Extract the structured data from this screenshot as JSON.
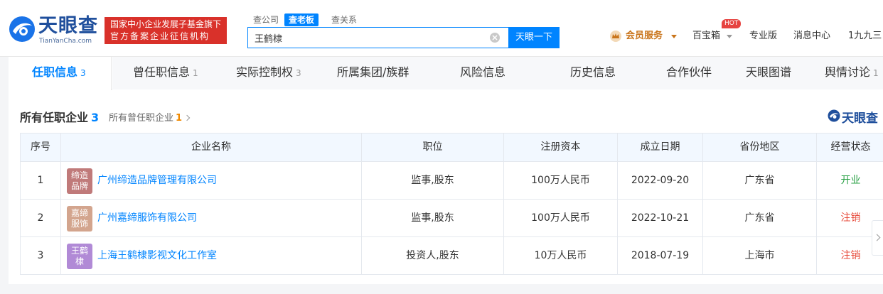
{
  "header": {
    "logo_cn": "天眼查",
    "logo_en": "TianYanCha.com",
    "badge_line1": "国家中小企业发展子基金旗下",
    "badge_line2": "官方备案企业征信机构",
    "search_tabs": [
      {
        "label": "查公司",
        "active": false
      },
      {
        "label": "查老板",
        "active": true
      },
      {
        "label": "查关系",
        "active": false
      }
    ],
    "search_value": "王鹤棣",
    "search_button": "天眼一下",
    "vip_label": "会员服务",
    "baobox_label": "百宝箱",
    "hot_badge": "HOT",
    "pro_label": "专业版",
    "messages_label": "消息中心",
    "user_label": "1九九三"
  },
  "tabs": [
    {
      "label": "任职信息",
      "count": "3",
      "active": true
    },
    {
      "label": "曾任职信息",
      "count": "1"
    },
    {
      "label": "实际控制权",
      "count": "3"
    },
    {
      "label": "所属集团/族群",
      "count": ""
    },
    {
      "label": "风险信息",
      "count": ""
    },
    {
      "label": "历史信息",
      "count": ""
    },
    {
      "label": "合作伙伴",
      "count": ""
    },
    {
      "label": "天眼图谱",
      "count": ""
    },
    {
      "label": "舆情讨论",
      "count": "1"
    }
  ],
  "section": {
    "title": "所有任职企业",
    "count": "3",
    "past_label": "所有曾任职企业",
    "past_count": "1",
    "brand": "天眼查"
  },
  "table": {
    "headers": [
      "序号",
      "企业名称",
      "职位",
      "注册资本",
      "成立日期",
      "省份地区",
      "经营状态"
    ],
    "rows": [
      {
        "index": "1",
        "logo_text": "缔造品牌",
        "logo_color": "#c07a7a",
        "name": "广州缔造品牌管理有限公司",
        "position": "监事,股东",
        "capital": "100万人民币",
        "date": "2022-09-20",
        "region": "广东省",
        "status": "开业",
        "status_type": "open"
      },
      {
        "index": "2",
        "logo_text": "嘉缔服饰",
        "logo_color": "#d3a58e",
        "name": "广州嘉缔服饰有限公司",
        "position": "监事,股东",
        "capital": "100万人民币",
        "date": "2022-10-21",
        "region": "广东省",
        "status": "注销",
        "status_type": "closed"
      },
      {
        "index": "3",
        "logo_text": "王鹤棣",
        "logo_color": "#b18ad6",
        "name": "上海王鹤棣影视文化工作室",
        "position": "投资人,股东",
        "capital": "10万人民币",
        "date": "2018-07-19",
        "region": "上海市",
        "status": "注销",
        "status_type": "closed"
      }
    ]
  },
  "colors": {
    "accent": "#0084ff",
    "brand_red": "#d9312a",
    "status_open": "#2aa146",
    "status_closed": "#e74c3c"
  }
}
